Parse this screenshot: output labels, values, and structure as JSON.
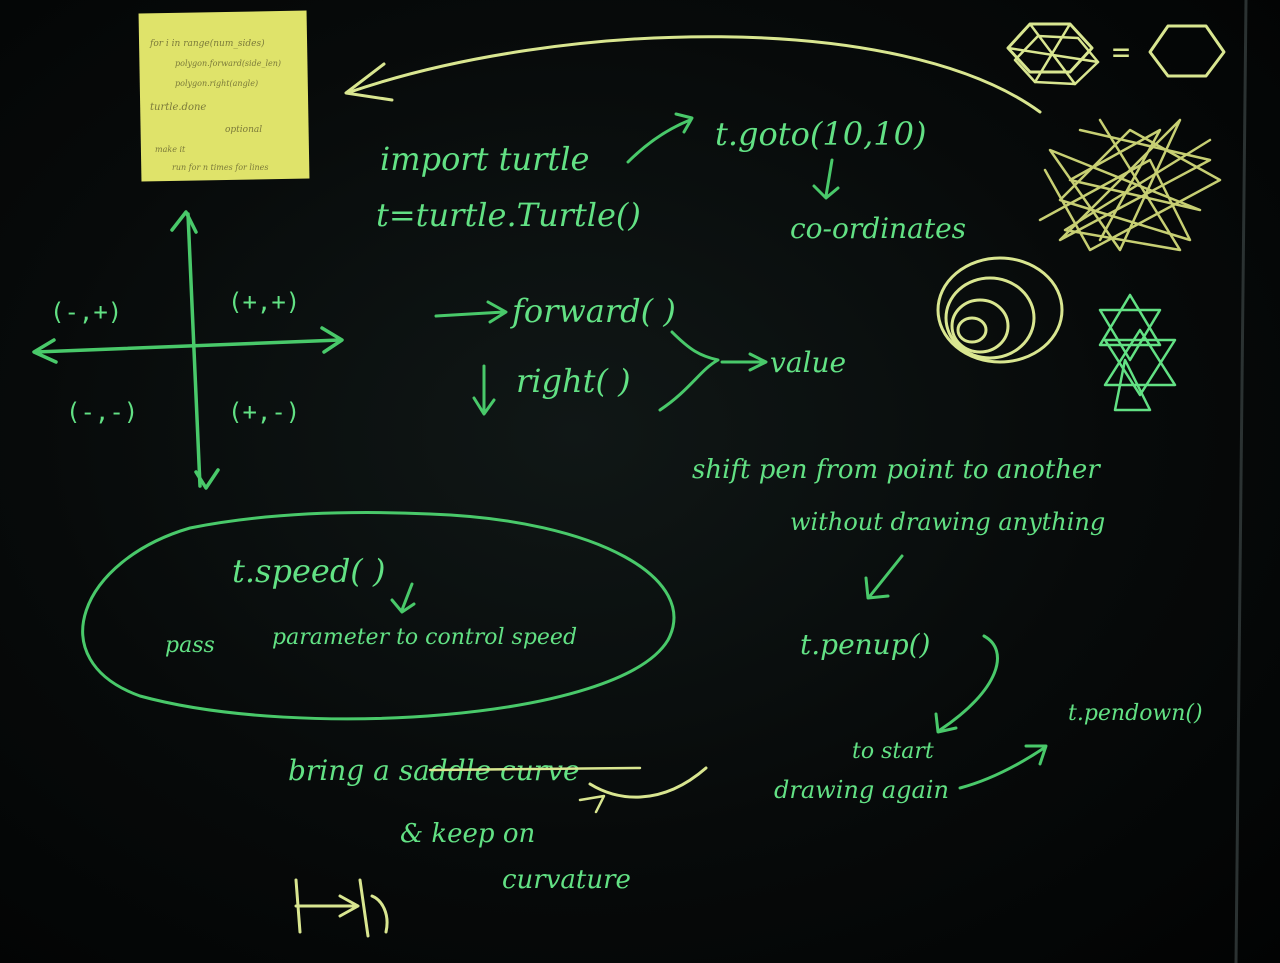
{
  "colors": {
    "board": "#070a0a",
    "chalk_green": "#49c96a",
    "chalk_bright_green": "#62e184",
    "chalk_yellow": "#d9e690",
    "sticky_note": "#dfe36a",
    "note_ink": "#7b7a3a"
  },
  "sticky_note": {
    "lines": [
      "for i in range(num_sides)",
      "polygon.forward(side_len)",
      "polygon.right(angle)",
      "turtle.done",
      "optional",
      "make it",
      "run for n times for lines"
    ]
  },
  "code": {
    "line1": "import turtle",
    "line2": "t=turtle.Turtle()",
    "goto": "t.goto(10,10)",
    "goto_note": "co-ordinates"
  },
  "axes": {
    "q_top_left": "(-,+)",
    "q_top_right": "(+,+)",
    "q_bottom_left": "(-,-)",
    "q_bottom_right": "(+,-)"
  },
  "commands": {
    "forward": "forward( )",
    "right": "right( )",
    "value": "value"
  },
  "speed": {
    "call": "t.speed( )",
    "note_pass": "pass",
    "note_rest": "parameter to control speed"
  },
  "pen": {
    "shift_line1": "shift pen from point to another",
    "shift_line2": "without drawing anything",
    "penup": "t.penup()",
    "start_line1": "to start",
    "start_line2": "drawing again",
    "pendown": "t.pendown()"
  },
  "saddle": {
    "line1": "bring a saddle curve",
    "line2": "& keep on",
    "line3": "curvature"
  },
  "drawings": {
    "hexagon_equals": "="
  }
}
